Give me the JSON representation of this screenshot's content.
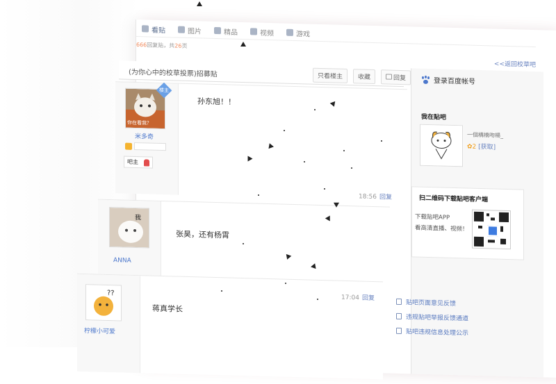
{
  "nav": {
    "tabs": [
      "看贴",
      "图片",
      "精品",
      "视频",
      "游戏"
    ]
  },
  "thread_info": {
    "reply_count": "666",
    "reply_suffix": "回复贴，共",
    "page_count": "26",
    "page_suffix": "页",
    "back_link": "<<返回校草吧"
  },
  "post_header": {
    "title": "(为你心中的校草投票)招募贴",
    "btn_only_op": "只看楼主",
    "btn_collect": "收藏",
    "btn_reply": "回复"
  },
  "right": {
    "login": "登录百度帐号",
    "my_tieba": "我在贴吧",
    "my_name": "一個構橋吻楊_",
    "my_level": "2",
    "my_get": "[获取]",
    "qr_title": "扫二维码下载贴吧客户端",
    "qr_text1": "下载贴吧APP",
    "qr_text2": "看高清直播、视频！",
    "links": [
      "贴吧页面意见反馈",
      "违规贴吧举报反馈通道",
      "贴吧违规信息处理公示"
    ]
  },
  "posts": [
    {
      "user": "米多奇",
      "avatar_caption": "你在看我？",
      "badge": "楼主",
      "tag": "吧主",
      "content": "孙东旭！！",
      "time": "18:56",
      "reply": "回复"
    },
    {
      "user": "ANNA",
      "content": "张昊，还有杨霄",
      "time": "",
      "reply": ""
    },
    {
      "user": "柠檬小可爱",
      "content": "蒋真学长",
      "time": "17:04",
      "reply": "回复"
    }
  ]
}
